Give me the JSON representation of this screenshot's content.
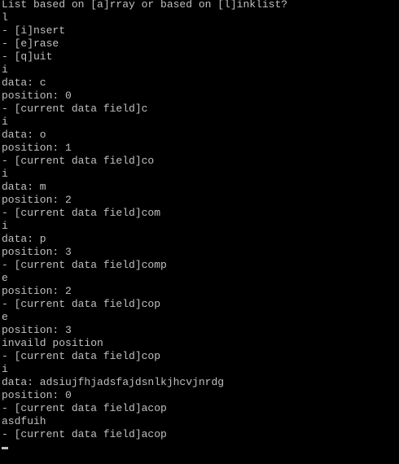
{
  "console": {
    "lines": [
      "List based on [a]rray or based on [l]inklist?",
      "l",
      "- [i]nsert",
      "- [e]rase",
      "- [q]uit",
      "i",
      "data: c",
      "position: 0",
      "- [current data field]c",
      "i",
      "data: o",
      "position: 1",
      "- [current data field]co",
      "i",
      "data: m",
      "position: 2",
      "- [current data field]com",
      "i",
      "data: p",
      "position: 3",
      "- [current data field]comp",
      "e",
      "position: 2",
      "- [current data field]cop",
      "e",
      "position: 3",
      "invaild position",
      "- [current data field]cop",
      "i",
      "data: adsiujfhjadsfajdsnlkjhcvjnrdg",
      "position: 0",
      "- [current data field]acop",
      "asdfuih",
      "- [current data field]acop"
    ],
    "text_color": "#c0c0c0",
    "background_color": "#000000"
  }
}
